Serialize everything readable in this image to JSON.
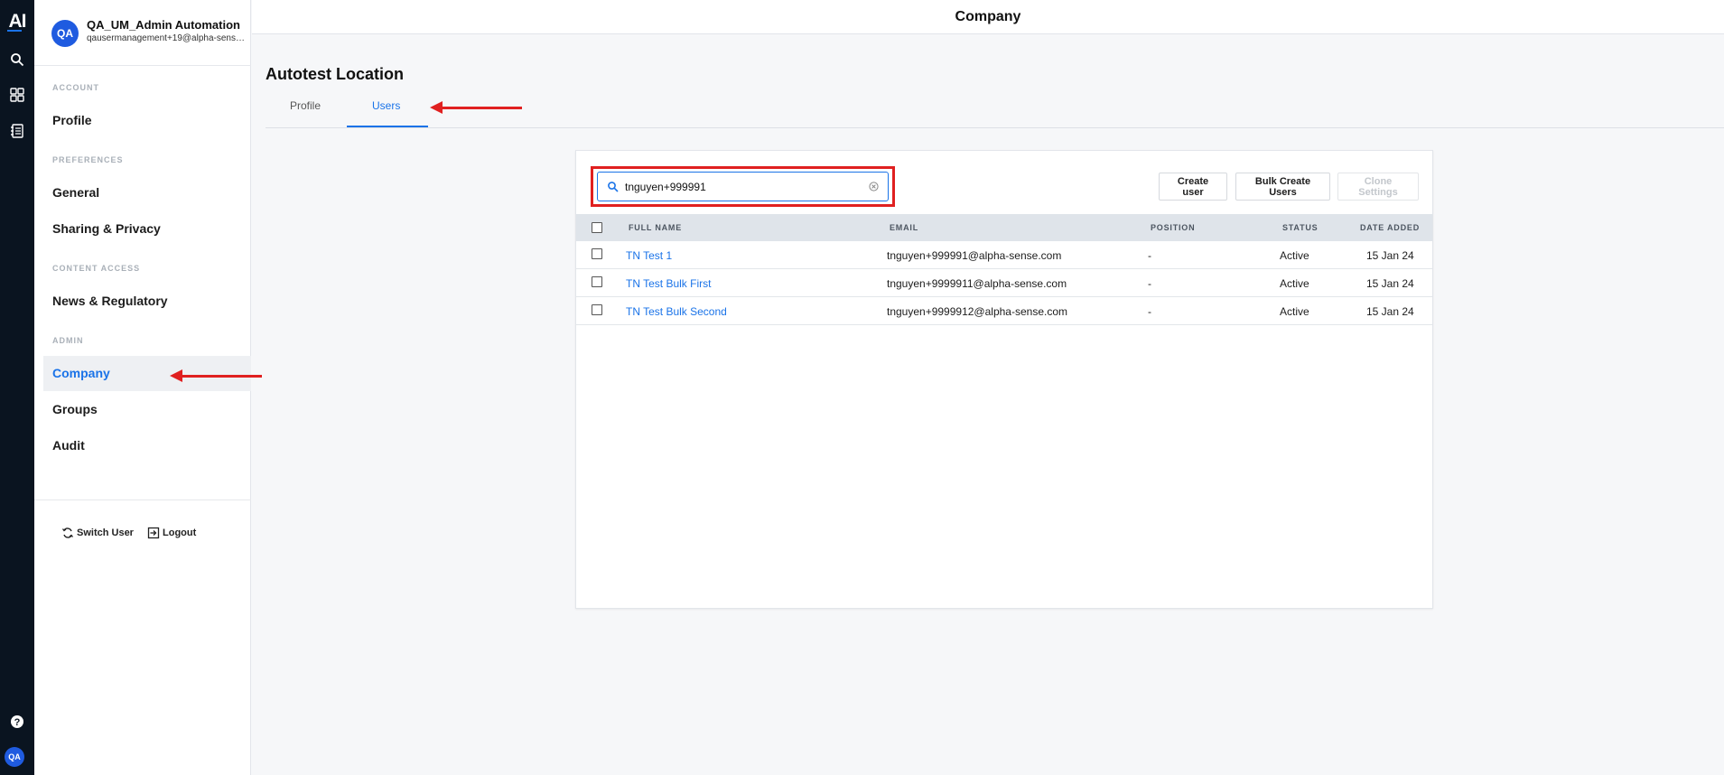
{
  "rail": {
    "logo": "AI",
    "avatar_initials": "QA"
  },
  "user": {
    "initials": "QA",
    "name": "QA_UM_Admin Automation",
    "email": "qausermanagement+19@alpha-sense.com"
  },
  "sidebar": {
    "sections": [
      {
        "label": "ACCOUNT",
        "items": [
          {
            "label": "Profile"
          }
        ]
      },
      {
        "label": "PREFERENCES",
        "items": [
          {
            "label": "General"
          },
          {
            "label": "Sharing & Privacy"
          }
        ]
      },
      {
        "label": "CONTENT ACCESS",
        "items": [
          {
            "label": "News & Regulatory"
          }
        ]
      },
      {
        "label": "ADMIN",
        "items": [
          {
            "label": "Company",
            "active": true
          },
          {
            "label": "Groups"
          },
          {
            "label": "Audit"
          }
        ]
      }
    ],
    "switch_user": "Switch User",
    "logout": "Logout"
  },
  "header": {
    "title": "Company"
  },
  "page": {
    "title": "Autotest Location",
    "tabs": [
      {
        "label": "Profile",
        "active": false
      },
      {
        "label": "Users",
        "active": true
      }
    ]
  },
  "search": {
    "value": "tnguyen+999991",
    "placeholder": ""
  },
  "actions": {
    "create_user": "Create user",
    "bulk_create": "Bulk Create Users",
    "clone_settings": "Clone Settings"
  },
  "table": {
    "columns": [
      "FULL NAME",
      "EMAIL",
      "POSITION",
      "STATUS",
      "DATE ADDED"
    ],
    "rows": [
      {
        "name": "TN Test 1",
        "email": "tnguyen+999991@alpha-sense.com",
        "position": "-",
        "status": "Active",
        "date": "15 Jan 24"
      },
      {
        "name": "TN Test Bulk First",
        "email": "tnguyen+9999911@alpha-sense.com",
        "position": "-",
        "status": "Active",
        "date": "15 Jan 24"
      },
      {
        "name": "TN Test Bulk Second",
        "email": "tnguyen+9999912@alpha-sense.com",
        "position": "-",
        "status": "Active",
        "date": "15 Jan 24"
      }
    ]
  },
  "colors": {
    "accent": "#1a73e8",
    "annotation": "#e02020",
    "rail": "#0a1420"
  }
}
